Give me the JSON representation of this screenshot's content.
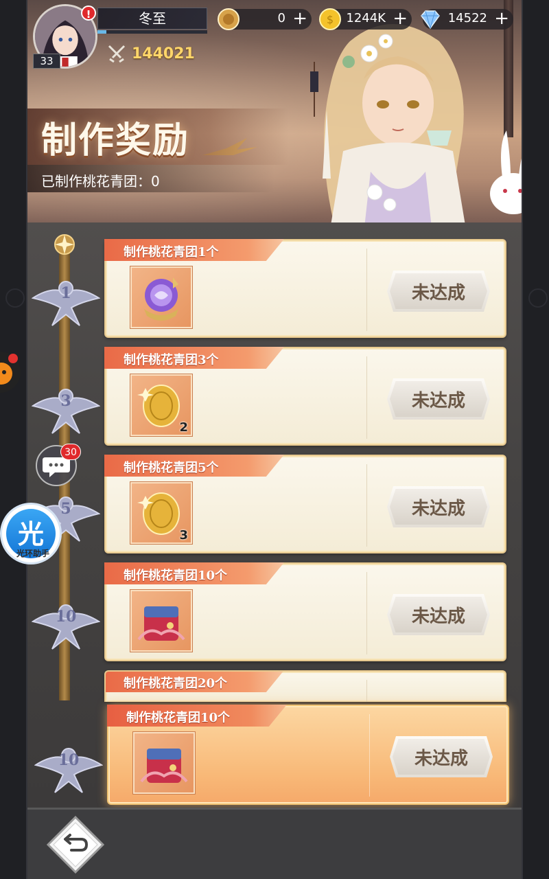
{
  "player": {
    "name": "冬至",
    "level": "33",
    "xp_fraction": 0.08,
    "power": "144021",
    "alert_badge": "!"
  },
  "resources": [
    {
      "icon": "bronze-coin-icon",
      "value": "0"
    },
    {
      "icon": "gold-coin-icon",
      "value": "1244K"
    },
    {
      "icon": "diamond-icon",
      "value": "14522"
    }
  ],
  "banner": {
    "title": "制作奖励",
    "progress": "已制作桃花青团：0"
  },
  "milestones": [
    {
      "threshold": "1",
      "task": "制作桃花青团1个",
      "item_icon": "purple-crystal-orb-icon",
      "count": "",
      "status": "未达成"
    },
    {
      "threshold": "3",
      "task": "制作桃花青团3个",
      "item_icon": "gold-coin-icon",
      "count": "2",
      "status": "未达成"
    },
    {
      "threshold": "5",
      "task": "制作桃花青团5个",
      "item_icon": "gold-coin-icon",
      "count": "3",
      "status": "未达成"
    },
    {
      "threshold": "10",
      "task": "制作桃花青团10个",
      "item_icon": "red-gift-bag-icon",
      "count": "",
      "status": "未达成"
    },
    {
      "threshold": "20",
      "task": "制作桃花青团20个",
      "item_icon": "",
      "count": "",
      "status": ""
    }
  ],
  "pinned": {
    "threshold": "10",
    "task": "制作桃花青团10个",
    "item_icon": "red-gift-bag-icon",
    "status": "未达成"
  },
  "widgets": {
    "chat_badge": "30",
    "assistant_glyph": "光",
    "assistant_label": "光环助手"
  },
  "colors": {
    "card_tab": "#e96a47",
    "gold_text": "#ffd66a",
    "alert": "#e0292c"
  }
}
